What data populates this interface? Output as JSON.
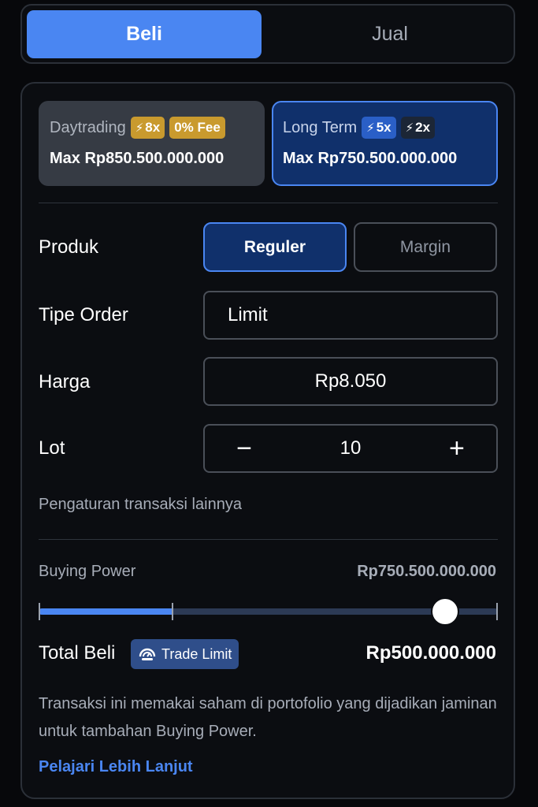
{
  "tabs": {
    "buy": "Beli",
    "sell": "Jual"
  },
  "cards": {
    "daytrading": {
      "name": "Daytrading",
      "badge1": "8x",
      "badge2": "0% Fee",
      "max": "Max Rp850.500.000.000"
    },
    "longterm": {
      "name": "Long Term",
      "badge1": "5x",
      "badge2": "2x",
      "max": "Max Rp750.500.000.000"
    }
  },
  "product": {
    "label": "Produk",
    "options": [
      "Reguler",
      "Margin"
    ],
    "selected": "Reguler"
  },
  "order_type": {
    "label": "Tipe Order",
    "value": "Limit"
  },
  "price": {
    "label": "Harga",
    "value": "Rp8.050"
  },
  "lot": {
    "label": "Lot",
    "value": "10",
    "minus": "−",
    "plus": "+"
  },
  "more_settings": "Pengaturan transaksi lainnya",
  "buying_power": {
    "label": "Buying Power",
    "value": "Rp750.500.000.000",
    "slider_fill_fraction": 0.29,
    "slider_thumb_fraction": 0.885
  },
  "total": {
    "label": "Total Beli",
    "badge": "Trade Limit",
    "value": "Rp500.000.000"
  },
  "note": "Transaksi ini memakai saham di portofolio yang dijadikan jaminan untuk tambahan Buying Power.",
  "learn_more": "Pelajari Lebih Lanjut",
  "colors": {
    "accent": "#4a86f2",
    "gold": "#c99a2e",
    "selected_bg": "#10306b"
  }
}
